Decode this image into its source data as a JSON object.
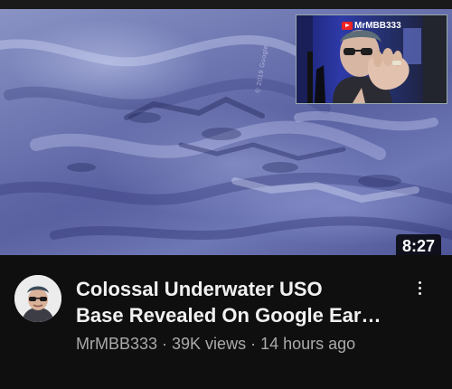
{
  "video": {
    "title_line1": "Colossal Underwater USO",
    "title_line2": "Base Revealed On Google Ear…",
    "channel": "MrMBB333",
    "views": "39K views",
    "age": "14 hours ago",
    "separator": " · ",
    "duration": "8:27",
    "thumbnail": {
      "pip_channel_tag": "MrMBB333",
      "watermark": "© 2019 Google"
    }
  },
  "icons": {
    "more": "more-vert-icon",
    "avatar": "channel-avatar"
  }
}
